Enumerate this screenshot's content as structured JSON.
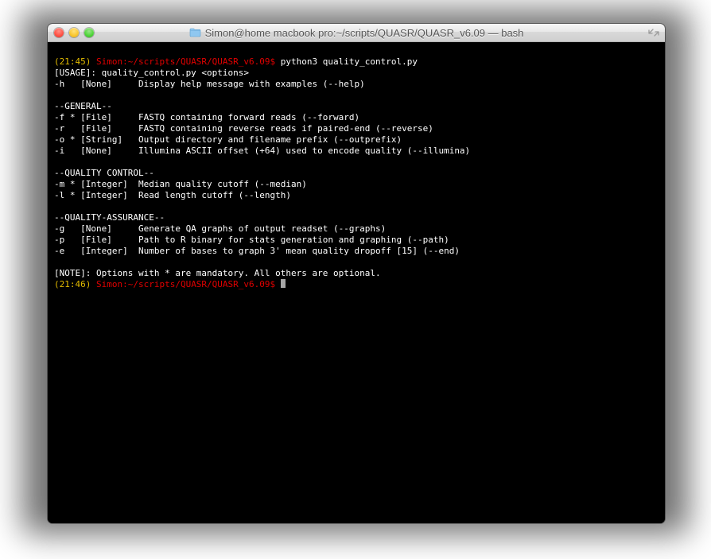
{
  "window": {
    "title": "Simon@home macbook pro:~/scripts/QUASR/QUASR_v6.09 — bash"
  },
  "lines": {
    "l0_time": "(21:45)",
    "l0_path": " Simon:~/scripts/QUASR/QUASR_v6.09$",
    "l0_cmd": " python3 quality_control.py",
    "l1": "[USAGE]: quality_control.py <options>",
    "l2": "-h   [None]     Display help message with examples (--help)",
    "l3": "",
    "l4": "--GENERAL--",
    "l5": "-f * [File]     FASTQ containing forward reads (--forward)",
    "l6": "-r   [File]     FASTQ containing reverse reads if paired-end (--reverse)",
    "l7": "-o * [String]   Output directory and filename prefix (--outprefix)",
    "l8": "-i   [None]     Illumina ASCII offset (+64) used to encode quality (--illumina)",
    "l9": "",
    "l10": "--QUALITY CONTROL--",
    "l11": "-m * [Integer]  Median quality cutoff (--median)",
    "l12": "-l * [Integer]  Read length cutoff (--length)",
    "l13": "",
    "l14": "--QUALITY-ASSURANCE--",
    "l15": "-g   [None]     Generate QA graphs of output readset (--graphs)",
    "l16": "-p   [File]     Path to R binary for stats generation and graphing (--path)",
    "l17": "-e   [Integer]  Number of bases to graph 3' mean quality dropoff [15] (--end)",
    "l18": "",
    "l19": "[NOTE]: Options with * are mandatory. All others are optional.",
    "l20_time": "(21:46)",
    "l20_path": " Simon:~/scripts/QUASR/QUASR_v6.09$",
    "l20_sp": " "
  }
}
